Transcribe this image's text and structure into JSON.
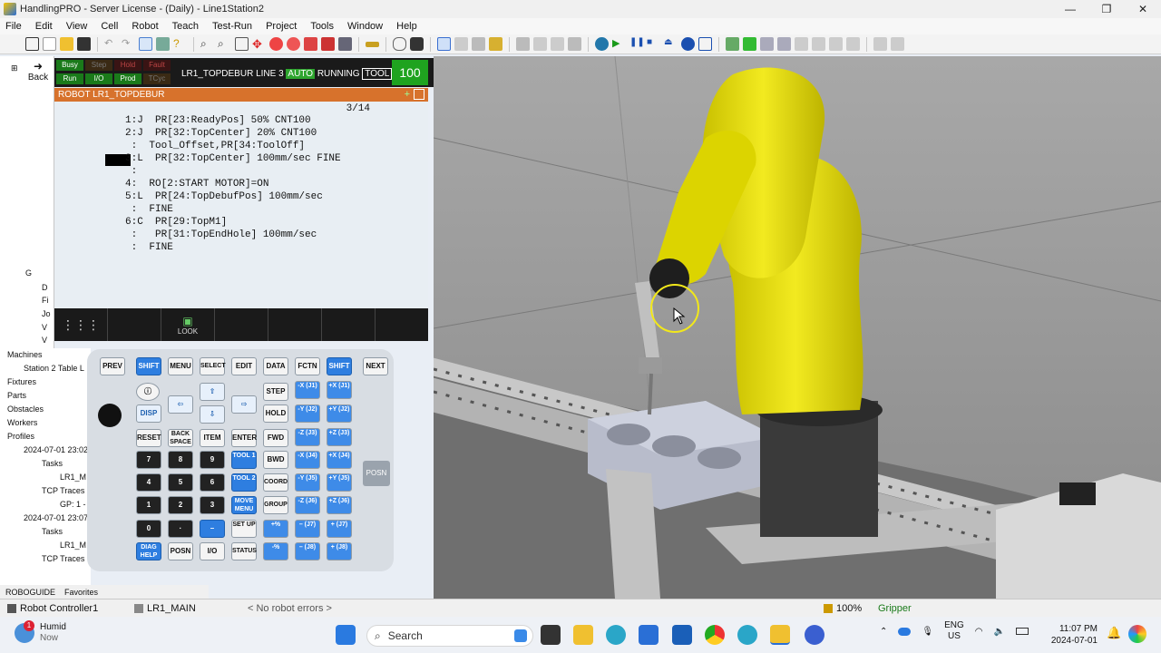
{
  "window": {
    "title": "HandlingPRO - Server License - (Daily) - Line1Station2",
    "controls": [
      "—",
      "❐",
      "✕"
    ]
  },
  "menu": [
    "File",
    "Edit",
    "View",
    "Cell",
    "Robot",
    "Teach",
    "Test-Run",
    "Project",
    "Tools",
    "Window",
    "Help"
  ],
  "left_panel": {
    "back_label": "Back",
    "tree_top": [
      "G",
      "D",
      "Fi",
      "Jo",
      "V",
      "V"
    ],
    "tree_lower": [
      "Machines",
      "Station 2 Table L",
      "Fixtures",
      "Parts",
      "Obstacles",
      "Workers",
      "Profiles",
      "2024-07-01 23:02",
      "Tasks",
      "LR1_M",
      "TCP Traces",
      "GP: 1 -",
      "2024-07-01 23:07",
      "Tasks",
      "LR1_M",
      "TCP Traces"
    ],
    "tabs": [
      "ROBOGUIDE",
      "Favorites"
    ]
  },
  "pendant": {
    "leds": [
      "Busy",
      "Step",
      "Hold",
      "Fault",
      "Run",
      "I/O",
      "Prod",
      "TCyc"
    ],
    "status_line": "LR1_TOPDEBUR LINE 3",
    "auto_label": "AUTO",
    "running_label": "RUNNING",
    "tool_label": "TOOL",
    "override": "100",
    "override_unit": "%",
    "program_title": "ROBOT  LR1_TOPDEBUR",
    "page": "3/14",
    "lines": [
      "1:J  PR[23:ReadyPos] 50% CNT100",
      "2:J  PR[32:TopCenter] 20% CNT100",
      " :  Tool_Offset,PR[34:ToolOff]",
      "3:L  PR[32:TopCenter] 100mm/sec FINE",
      " :",
      "4:  RO[2:START MOTOR]=ON",
      "5:L  PR[24:TopDebufPos] 100mm/sec",
      " :  FINE",
      "6:C  PR[29:TopM1]",
      " :   PR[31:TopEndHole] 100mm/sec",
      " :  FINE"
    ],
    "fkey_look": "LOOK"
  },
  "keypad": {
    "top_row": [
      "PREV",
      "SHIFT",
      "MENU",
      "SELECT",
      "EDIT",
      "DATA",
      "FCTN",
      "SHIFT",
      "NEXT"
    ],
    "disp": "DISP",
    "step": "STEP",
    "hold": "HOLD",
    "fwd": "FWD",
    "bwd": "BWD",
    "coord": "COORD",
    "group": "GROUP",
    "reset": "RESET",
    "backspace": "BACK SPACE",
    "item": "ITEM",
    "enter": "ENTER",
    "tool1": "TOOL 1",
    "tool2": "TOOL 2",
    "move_menu": "MOVE MENU",
    "setup": "SET UP",
    "diag_help": "DIAG HELP",
    "posn": "POSN",
    "io": "I/O",
    "status": "STATUS",
    "posn_side": "POSN",
    "nums": [
      "7",
      "8",
      "9",
      "4",
      "5",
      "6",
      "1",
      "2",
      "3",
      "0",
      "·",
      "–"
    ],
    "jog": [
      "-X (J1)",
      "+X (J1)",
      "-Y (J2)",
      "+Y (J2)",
      "-Z (J3)",
      "+Z (J3)",
      "-X (J4)",
      "+X (J4)",
      "-Y (J5)",
      "+Y (J5)",
      "-Z (J6)",
      "+Z (J6)",
      "– (J7)",
      "+ (J7)",
      "– (J8)",
      "+ (J8)"
    ]
  },
  "statusbar": {
    "controller": "Robot Controller1",
    "program": "LR1_MAIN",
    "errors": "< No robot errors >",
    "zoom": "100%",
    "tool": "Gripper"
  },
  "taskbar": {
    "weather_title": "Humid",
    "weather_sub": "Now",
    "weather_badge": "1",
    "search_placeholder": "Search",
    "lang1": "ENG",
    "lang2": "US",
    "time": "11:07 PM",
    "date": "2024-07-01"
  },
  "colors": {
    "robot_yellow": "#e8de12",
    "auto_green": "#2ea52e",
    "orange_title": "#d7722c",
    "key_blue": "#2e7ee0"
  }
}
